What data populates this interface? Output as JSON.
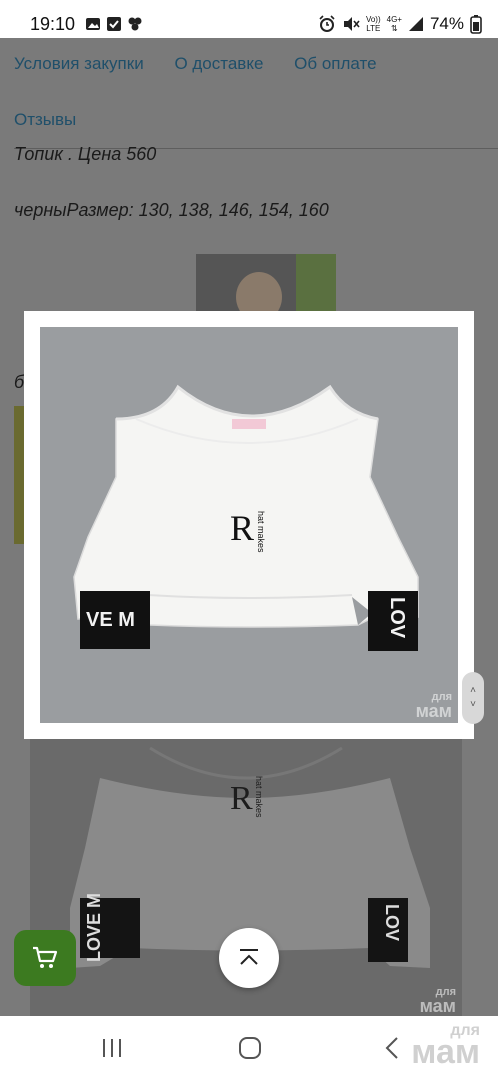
{
  "status_bar": {
    "time": "19:10",
    "left_icons": [
      "image-icon",
      "checkbox-icon",
      "app-cluster-icon"
    ],
    "right_icons": [
      "alarm-icon",
      "mute-icon",
      "volte-icon",
      "4g-icon",
      "signal-icon"
    ],
    "net_label_1": "Vo))",
    "net_label_2": "LTE",
    "gen_label": "4G+",
    "battery": "74%"
  },
  "nav_links": {
    "row1": [
      "Условия закупки",
      "О доставке",
      "Об оплате"
    ],
    "row2": [
      "Отзывы"
    ]
  },
  "content": {
    "title_line": "Топик . Цена 560",
    "size_line": "черныРазмер: 130, 138, 146, 154, 160",
    "side_letter": "б"
  },
  "product": {
    "logo_letter": "R",
    "logo_side_text": "hat makes",
    "band_left_text": "VE M",
    "band_right_text": "LOV"
  },
  "watermark": {
    "line1": "для",
    "line2": "мам"
  },
  "bg_product": {
    "logo_letter": "R",
    "logo_side_text": "hat makes",
    "band_left_text": "LOVE M",
    "band_right_text": "LOV"
  },
  "buttons": {
    "cart_icon": "cart-icon",
    "scroll_top_icon": "chevron-up-icon"
  },
  "system_nav": {
    "recents_icon": "recents-icon",
    "home_icon": "home-icon",
    "back_icon": "back-icon"
  },
  "colors": {
    "link": "#1f4f6a",
    "cart": "#3c7a20",
    "overlay": "#7a7a7a",
    "band": "#111111"
  }
}
